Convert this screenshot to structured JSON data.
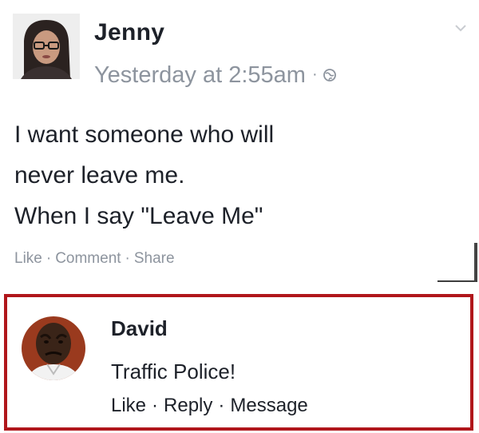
{
  "post": {
    "author": "Jenny",
    "timestamp": "Yesterday at 2:55am",
    "separator": "·",
    "audience_icon": "public-audience-icon",
    "menu_icon": "chevron-down-icon",
    "body_lines": [
      "I want someone who will",
      "never leave me.",
      "When I say \"Leave Me\""
    ],
    "actions": {
      "like": "Like",
      "comment": "Comment",
      "share": "Share",
      "dot": "·"
    }
  },
  "comment": {
    "author": "David",
    "text": "Traffic Police!",
    "actions": {
      "like": "Like",
      "reply": "Reply",
      "message": "Message",
      "dot": "·"
    },
    "highlight_color": "#b0161b"
  },
  "colors": {
    "text_primary": "#1d2129",
    "text_secondary": "#8d949e",
    "highlight": "#b0161b"
  }
}
